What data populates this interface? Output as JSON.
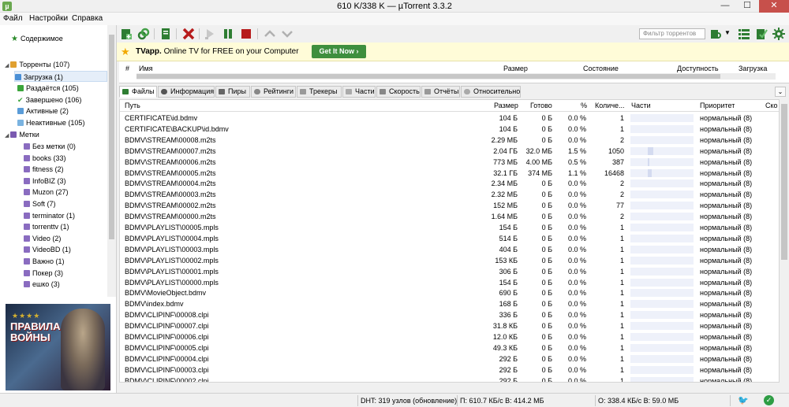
{
  "window": {
    "title": "610 K/338 K — µTorrent 3.3.2",
    "app_icon_glyph": "µ"
  },
  "menu": [
    "Файл",
    "Настройки",
    "Справка"
  ],
  "sidebar": {
    "content_label": "Содержимое",
    "torrents": "Торренты (107)",
    "items": [
      {
        "label": "Загрузка (1)",
        "color": "#4a8fd6"
      },
      {
        "label": "Раздаётся (105)",
        "color": "#3aa53a"
      },
      {
        "label": "Завершено (106)",
        "color": "#3aa53a"
      },
      {
        "label": "Активные (2)",
        "color": "#5a9cd8"
      },
      {
        "label": "Неактивные (105)",
        "color": "#7ab3e0"
      }
    ],
    "labels_title": "Метки",
    "labels": [
      "Без метки (0)",
      "books (33)",
      "fitness (2)",
      "InfoBIZ (3)",
      "Muzon (27)",
      "Soft (7)",
      "terminator (1)",
      "torrenttv (1)",
      "Video (2)",
      "VideoBD (1)",
      "Важно (1)",
      "Покер (3)",
      "ешко (3)"
    ],
    "ad": {
      "stars": "★★★★",
      "title": "ПРАВИЛА ВОЙНЫ"
    }
  },
  "toolbar": {
    "filter_placeholder": "Фильтр торрентов"
  },
  "adbar": {
    "brand": "TVapp.",
    "text": " Online TV for FREE on your Computer",
    "button": "Get It Now ›"
  },
  "torrent_list": {
    "columns": [
      "#",
      "Имя",
      "Размер",
      "Состояние",
      "Доступность",
      "Загрузка"
    ]
  },
  "tabs": [
    "Файлы",
    "Информация",
    "Пиры",
    "Рейтинги",
    "Трекеры",
    "Части",
    "Скорость",
    "Отчёты",
    "Относительно"
  ],
  "files": {
    "columns": [
      "Путь",
      "Размер",
      "Готово",
      "%",
      "Количе...",
      "Части",
      "Приоритет",
      "Ско"
    ],
    "rows": [
      {
        "path": "CERTIFICATE\\id.bdmv",
        "size": "104 Б",
        "done": "0 Б",
        "pct": "0.0 %",
        "count": "1",
        "prio": "нормальный (8)",
        "fill": 0
      },
      {
        "path": "CERTIFICATE\\BACKUP\\id.bdmv",
        "size": "104 Б",
        "done": "0 Б",
        "pct": "0.0 %",
        "count": "1",
        "prio": "нормальный (8)",
        "fill": 0
      },
      {
        "path": "BDMV\\STREAM\\00008.m2ts",
        "size": "2.29 МБ",
        "done": "0 Б",
        "pct": "0.0 %",
        "count": "2",
        "prio": "нормальный (8)",
        "fill": 0
      },
      {
        "path": "BDMV\\STREAM\\00007.m2ts",
        "size": "2.04 ГБ",
        "done": "32.0 МБ",
        "pct": "1.5 %",
        "count": "1050",
        "prio": "нормальный (8)",
        "fill": 0.015
      },
      {
        "path": "BDMV\\STREAM\\00006.m2ts",
        "size": "773 МБ",
        "done": "4.00 МБ",
        "pct": "0.5 %",
        "count": "387",
        "prio": "нормальный (8)",
        "fill": 0.005
      },
      {
        "path": "BDMV\\STREAM\\00005.m2ts",
        "size": "32.1 ГБ",
        "done": "374 МБ",
        "pct": "1.1 %",
        "count": "16468",
        "prio": "нормальный (8)",
        "fill": 0.011
      },
      {
        "path": "BDMV\\STREAM\\00004.m2ts",
        "size": "2.34 МБ",
        "done": "0 Б",
        "pct": "0.0 %",
        "count": "2",
        "prio": "нормальный (8)",
        "fill": 0
      },
      {
        "path": "BDMV\\STREAM\\00003.m2ts",
        "size": "2.32 МБ",
        "done": "0 Б",
        "pct": "0.0 %",
        "count": "2",
        "prio": "нормальный (8)",
        "fill": 0
      },
      {
        "path": "BDMV\\STREAM\\00002.m2ts",
        "size": "152 МБ",
        "done": "0 Б",
        "pct": "0.0 %",
        "count": "77",
        "prio": "нормальный (8)",
        "fill": 0
      },
      {
        "path": "BDMV\\STREAM\\00000.m2ts",
        "size": "1.64 МБ",
        "done": "0 Б",
        "pct": "0.0 %",
        "count": "2",
        "prio": "нормальный (8)",
        "fill": 0
      },
      {
        "path": "BDMV\\PLAYLIST\\00005.mpls",
        "size": "154 Б",
        "done": "0 Б",
        "pct": "0.0 %",
        "count": "1",
        "prio": "нормальный (8)",
        "fill": 0
      },
      {
        "path": "BDMV\\PLAYLIST\\00004.mpls",
        "size": "514 Б",
        "done": "0 Б",
        "pct": "0.0 %",
        "count": "1",
        "prio": "нормальный (8)",
        "fill": 0
      },
      {
        "path": "BDMV\\PLAYLIST\\00003.mpls",
        "size": "404 Б",
        "done": "0 Б",
        "pct": "0.0 %",
        "count": "1",
        "prio": "нормальный (8)",
        "fill": 0
      },
      {
        "path": "BDMV\\PLAYLIST\\00002.mpls",
        "size": "153 КБ",
        "done": "0 Б",
        "pct": "0.0 %",
        "count": "1",
        "prio": "нормальный (8)",
        "fill": 0
      },
      {
        "path": "BDMV\\PLAYLIST\\00001.mpls",
        "size": "306 Б",
        "done": "0 Б",
        "pct": "0.0 %",
        "count": "1",
        "prio": "нормальный (8)",
        "fill": 0
      },
      {
        "path": "BDMV\\PLAYLIST\\00000.mpls",
        "size": "154 Б",
        "done": "0 Б",
        "pct": "0.0 %",
        "count": "1",
        "prio": "нормальный (8)",
        "fill": 0
      },
      {
        "path": "BDMV\\MovieObject.bdmv",
        "size": "690 Б",
        "done": "0 Б",
        "pct": "0.0 %",
        "count": "1",
        "prio": "нормальный (8)",
        "fill": 0
      },
      {
        "path": "BDMV\\index.bdmv",
        "size": "168 Б",
        "done": "0 Б",
        "pct": "0.0 %",
        "count": "1",
        "prio": "нормальный (8)",
        "fill": 0
      },
      {
        "path": "BDMV\\CLIPINF\\00008.clpi",
        "size": "336 Б",
        "done": "0 Б",
        "pct": "0.0 %",
        "count": "1",
        "prio": "нормальный (8)",
        "fill": 0
      },
      {
        "path": "BDMV\\CLIPINF\\00007.clpi",
        "size": "31.8 КБ",
        "done": "0 Б",
        "pct": "0.0 %",
        "count": "1",
        "prio": "нормальный (8)",
        "fill": 0
      },
      {
        "path": "BDMV\\CLIPINF\\00006.clpi",
        "size": "12.0 КБ",
        "done": "0 Б",
        "pct": "0.0 %",
        "count": "1",
        "prio": "нормальный (8)",
        "fill": 0
      },
      {
        "path": "BDMV\\CLIPINF\\00005.clpi",
        "size": "49.3 КБ",
        "done": "0 Б",
        "pct": "0.0 %",
        "count": "1",
        "prio": "нормальный (8)",
        "fill": 0
      },
      {
        "path": "BDMV\\CLIPINF\\00004.clpi",
        "size": "292 Б",
        "done": "0 Б",
        "pct": "0.0 %",
        "count": "1",
        "prio": "нормальный (8)",
        "fill": 0
      },
      {
        "path": "BDMV\\CLIPINF\\00003.clpi",
        "size": "292 Б",
        "done": "0 Б",
        "pct": "0.0 %",
        "count": "1",
        "prio": "нормальный (8)",
        "fill": 0
      },
      {
        "path": "BDMV\\CLIPINF\\00002.clpi",
        "size": "292 Б",
        "done": "0 Б",
        "pct": "0.0 %",
        "count": "1",
        "prio": "нормальный (8)",
        "fill": 0
      }
    ]
  },
  "status": {
    "dht": "DHT: 319 узлов  (обновление)",
    "download": "П: 610.7 КБ/с В: 414.2 МБ",
    "upload": "О: 338.4 КБ/с В: 59.0 МБ"
  }
}
